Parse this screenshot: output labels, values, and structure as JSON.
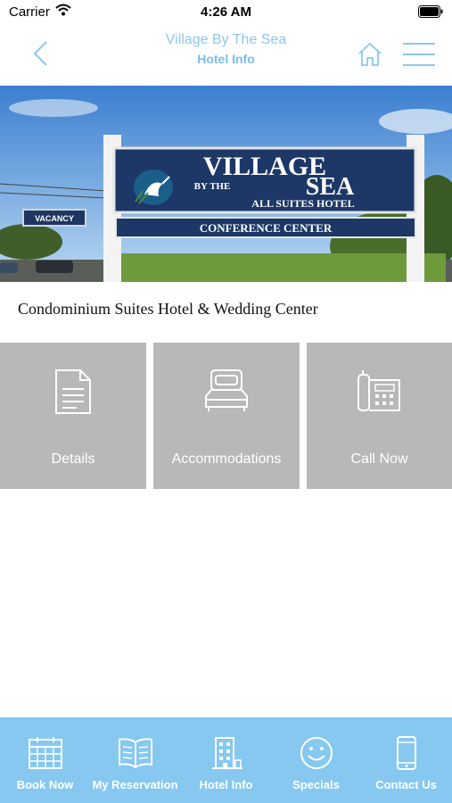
{
  "status_bar": {
    "carrier": "Carrier",
    "time": "4:26 AM"
  },
  "nav": {
    "app_title": "Village By The Sea",
    "page_title": "Hotel Info"
  },
  "hero": {
    "sign_line1": "VILLAGE",
    "sign_by_the": "BY THE",
    "sign_line2": "SEA",
    "sign_subtitle": "ALL SUITES HOTEL",
    "sign_conference": "CONFERENCE CENTER",
    "vacancy": "VACANCY"
  },
  "tagline": "Condominium Suites Hotel & Wedding Center",
  "tiles": [
    {
      "label": "Details",
      "icon": "document-icon"
    },
    {
      "label": "Accommodations",
      "icon": "bed-icon"
    },
    {
      "label": "Call Now",
      "icon": "phone-icon"
    }
  ],
  "tab_bar": [
    {
      "label": "Book Now",
      "icon": "calendar-icon"
    },
    {
      "label": "My Reservation",
      "icon": "book-icon"
    },
    {
      "label": "Hotel Info",
      "icon": "building-icon"
    },
    {
      "label": "Specials",
      "icon": "smiley-icon"
    },
    {
      "label": "Contact Us",
      "icon": "mobile-phone-icon"
    }
  ],
  "colors": {
    "accent": "#8cc6ee",
    "tab_bar": "#86c8f0",
    "tile": "#b8b8b8"
  }
}
